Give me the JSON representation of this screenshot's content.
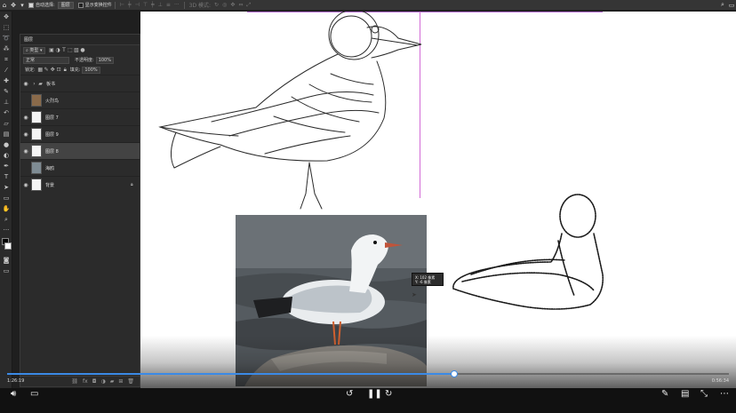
{
  "options_bar": {
    "auto_select_label": "自动选择:",
    "auto_select_value": "图层",
    "show_transform_label": "显示变换控件",
    "mode_3d_label": "3D 模式:"
  },
  "layers_panel": {
    "title": "图层",
    "filter_label": "类型",
    "blend_mode": "正常",
    "opacity_label": "不透明度:",
    "opacity_value": "100%",
    "lock_label": "锁定:",
    "fill_label": "填充:",
    "fill_value": "100%",
    "layers": [
      {
        "name": "板书",
        "type": "group",
        "visible": true,
        "selected": false
      },
      {
        "name": "火烈鸟",
        "type": "image",
        "visible": false,
        "selected": false
      },
      {
        "name": "图层 7",
        "type": "layer",
        "visible": true,
        "selected": false
      },
      {
        "name": "图层 9",
        "type": "layer",
        "visible": true,
        "selected": false
      },
      {
        "name": "图层 8",
        "type": "layer",
        "visible": true,
        "selected": true
      },
      {
        "name": "海鸥",
        "type": "image",
        "visible": false,
        "selected": false
      },
      {
        "name": "背景",
        "type": "background",
        "visible": true,
        "selected": false
      }
    ]
  },
  "canvas": {
    "tooltip_line1": "X: 102 像素",
    "tooltip_line2": "Y: -6 像素"
  },
  "player": {
    "current_time": "1:26:19",
    "total_time": "0:56:34",
    "progress": 0.62
  },
  "colors": {
    "accent": "#3b8ae6",
    "guide": "#d26bd6",
    "panel": "#2b2b2b",
    "selected_row": "#434343"
  }
}
